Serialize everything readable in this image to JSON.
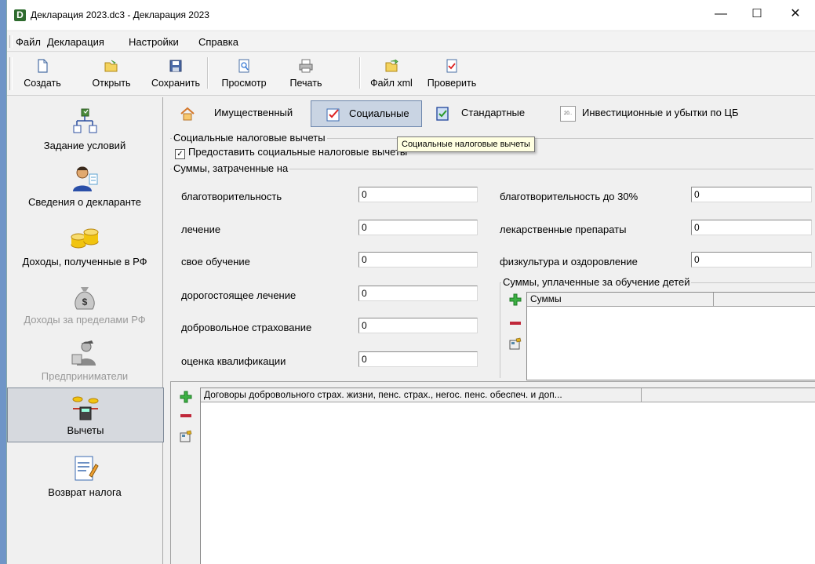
{
  "window": {
    "title": "Декларация 2023.dc3 - Декларация 2023",
    "app_icon_text": "D"
  },
  "window_controls": {
    "minimize": "—",
    "maximize": "☐",
    "close": "✕"
  },
  "menu": [
    "Файл",
    "Декларация",
    "Настройки",
    "Справка"
  ],
  "toolbar": {
    "create": "Создать",
    "open": "Открыть",
    "save": "Сохранить",
    "preview": "Просмотр",
    "print": "Печать",
    "xml": "Файл xml",
    "check": "Проверить"
  },
  "sidebar": {
    "items": [
      {
        "label": "Задание условий",
        "icon": "hierarchy-icon"
      },
      {
        "label": "Сведения о декларанте",
        "icon": "person-icon"
      },
      {
        "label": "Доходы, полученные в РФ",
        "icon": "coins-icon"
      },
      {
        "label": "Доходы за пределами РФ",
        "icon": "money-bag-icon"
      },
      {
        "label": "Предприниматели",
        "icon": "businessman-icon"
      },
      {
        "label": "Вычеты",
        "icon": "calculator-icon"
      },
      {
        "label": "Возврат налога",
        "icon": "document-pen-icon"
      }
    ]
  },
  "tabs": {
    "property": "Имущественный",
    "social": "Социальные",
    "standard": "Стандартные",
    "investment": "Инвестиционные и убытки по ЦБ",
    "investment_badge": "20.."
  },
  "social": {
    "group_title": "Социальные налоговые вычеты",
    "checkbox_label": "Предоставить социальные налоговые вычеты",
    "checkbox_mark": "✓",
    "tooltip": "Социальные налоговые вычеты",
    "sums_title": "Суммы, затраченные на",
    "left_fields": {
      "charity": {
        "label": "благотворительность",
        "value": "0"
      },
      "treatment": {
        "label": "лечение",
        "value": "0"
      },
      "education": {
        "label": "свое обучение",
        "value": "0"
      },
      "expensive_treatment": {
        "label": "дорогостоящее лечение",
        "value": "0"
      },
      "voluntary_insurance": {
        "label": "добровольное страхование",
        "value": "0"
      },
      "qualification": {
        "label": "оценка квалификации",
        "value": "0"
      }
    },
    "right_fields": {
      "charity30": {
        "label": "благотворительность до 30%",
        "value": "0"
      },
      "medicines": {
        "label": "лекарственные препараты",
        "value": "0"
      },
      "sport": {
        "label": "физкультура и оздоровление",
        "value": "0"
      }
    },
    "children_group_title": "Суммы, уплаченные за обучение детей",
    "children_grid_header": "Суммы",
    "contracts_grid_header": "Договоры добровольного страх. жизни, пенс. страх., негос. пенс. обеспеч. и доп..."
  }
}
